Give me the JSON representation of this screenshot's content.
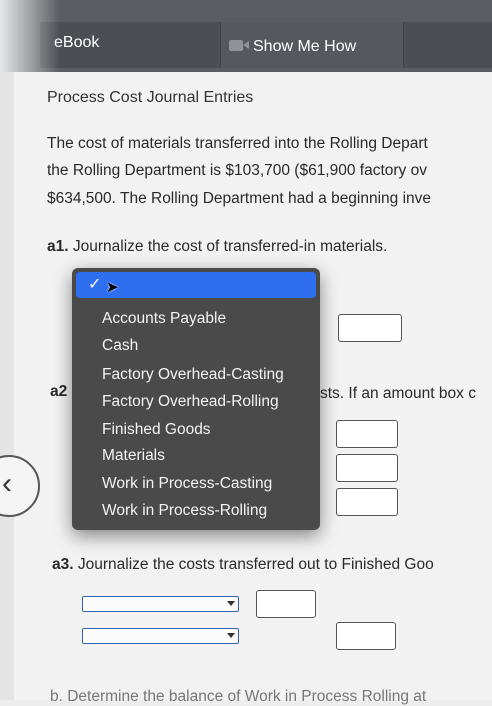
{
  "tabs": {
    "ebook": "eBook",
    "show_me_how": "Show Me How"
  },
  "content": {
    "title": "Process Cost Journal Entries",
    "paragraph": [
      "The cost of materials transferred into the Rolling Depart",
      "the Rolling Department is $103,700 ($61,900 factory ov",
      "$634,500. The Rolling Department had a beginning inve"
    ]
  },
  "questions": {
    "a1_num": "a1.",
    "a1_text": "Journalize the cost of transferred-in materials.",
    "a2_num": "a2",
    "a2_suffix": "sts. If an amount box c",
    "a3_num": "a3.",
    "a3_text": "Journalize the costs transferred out to Finished Goo",
    "b_text": "b.  Determine the balance of Work in Process        Rolling at"
  },
  "dropdown_menu": {
    "selected_mark": "✓",
    "items": [
      "Accounts Payable",
      "Cash",
      "Factory Overhead-Casting",
      "Factory Overhead-Rolling",
      "Finished Goods",
      "Materials",
      "Work in Process-Casting",
      "Work in Process-Rolling"
    ]
  }
}
